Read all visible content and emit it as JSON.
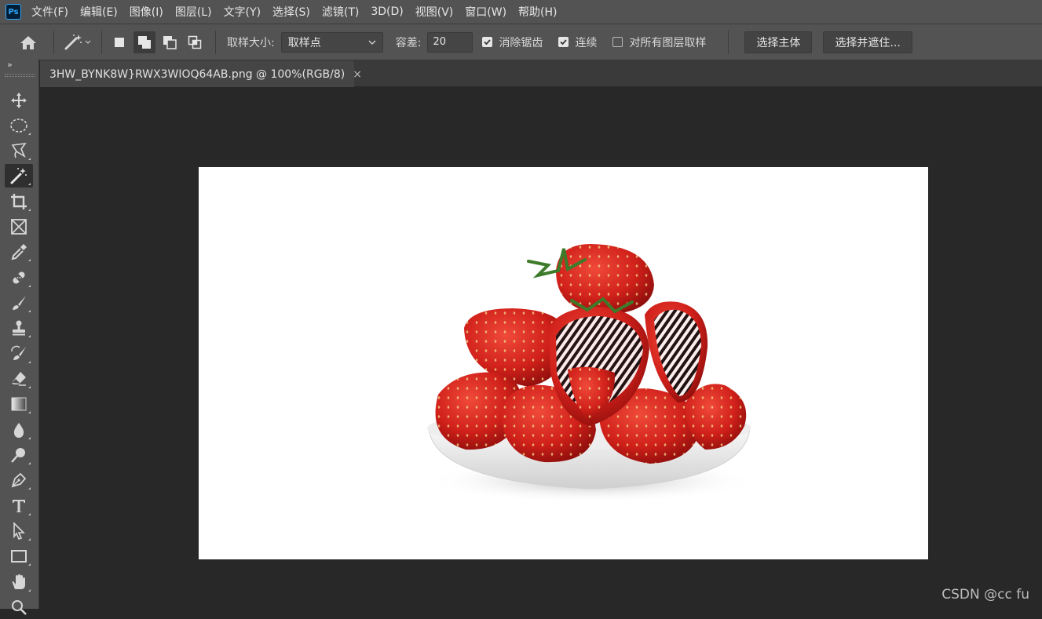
{
  "app": {
    "logo_text": "Ps"
  },
  "menu": [
    "文件(F)",
    "编辑(E)",
    "图像(I)",
    "图层(L)",
    "文字(Y)",
    "选择(S)",
    "滤镜(T)",
    "3D(D)",
    "视图(V)",
    "窗口(W)",
    "帮助(H)"
  ],
  "options": {
    "sample_size_label": "取样大小:",
    "sample_size_value": "取样点",
    "tolerance_label": "容差:",
    "tolerance_value": "20",
    "anti_alias_label": "消除锯齿",
    "anti_alias_checked": true,
    "contiguous_label": "连续",
    "contiguous_checked": true,
    "sample_all_layers_label": "对所有图层取样",
    "sample_all_layers_checked": false,
    "select_subject_label": "选择主体",
    "select_and_mask_label": "选择并遮住..."
  },
  "toolbar": {
    "collapse_glyph": "»",
    "tools": [
      "move-tool",
      "elliptical-marquee-tool",
      "lasso-tool",
      "magic-wand-tool",
      "crop-tool",
      "frame-tool",
      "eyedropper-tool",
      "healing-brush-tool",
      "brush-tool",
      "clone-stamp-tool",
      "history-brush-tool",
      "eraser-tool",
      "gradient-tool",
      "blur-tool",
      "dodge-tool",
      "pen-tool",
      "type-tool",
      "path-selection-tool",
      "rectangle-tool",
      "hand-tool",
      "zoom-tool"
    ],
    "active_tool": "magic-wand-tool"
  },
  "document": {
    "tab_title": "3HW_BYNK8W}RWX3WIOQ64AB.png @ 100%(RGB/8)",
    "close_glyph": "×"
  },
  "watermark": "CSDN @cc fu",
  "colors": {
    "ui_panel": "#535353",
    "ui_dark": "#282828",
    "strawberry": "#d8231c",
    "leaf": "#3d7a2a"
  }
}
